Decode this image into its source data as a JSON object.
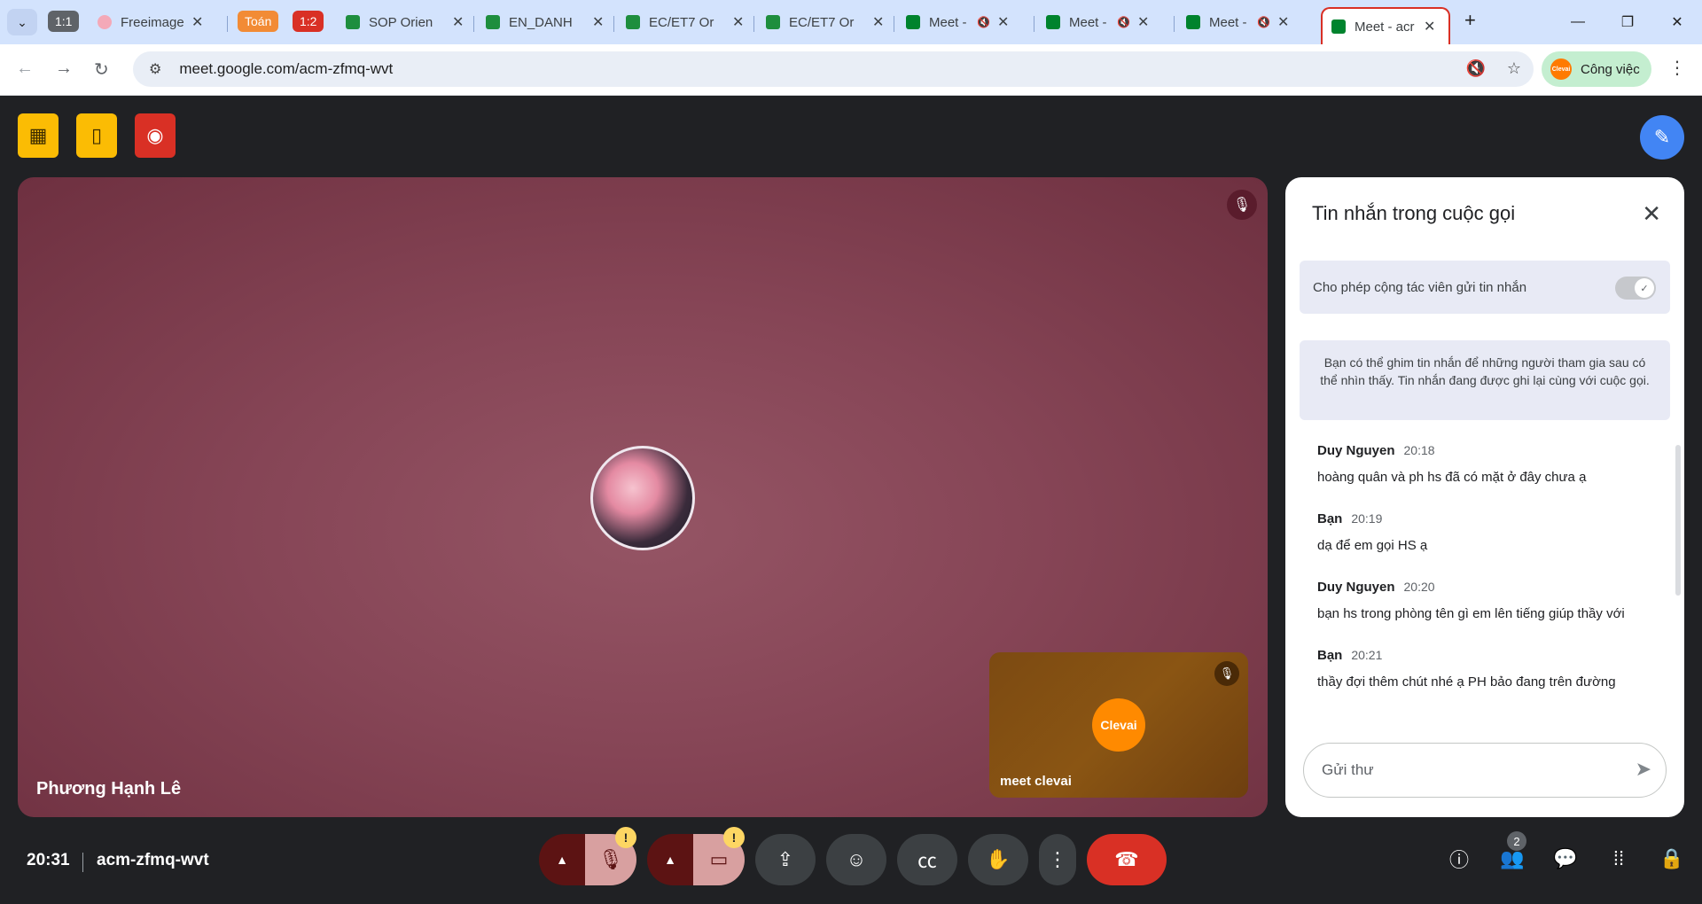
{
  "browser": {
    "tab_groups": [
      {
        "label": "1:1",
        "color": "#5f6368"
      },
      {
        "label": "Toán",
        "color": "#f28b35"
      },
      {
        "label": "1:2",
        "color": "#d93025"
      }
    ],
    "tabs": [
      {
        "title": "Freeimage",
        "favicon_color": "#f4a9b8"
      },
      {
        "title": "SOP Orien",
        "favicon_color": "#1e8e3e"
      },
      {
        "title": "EN_DANH",
        "favicon_color": "#1e8e3e"
      },
      {
        "title": "EC/ET7 Or",
        "favicon_color": "#1e8e3e"
      },
      {
        "title": "EC/ET7 Or",
        "favicon_color": "#1e8e3e"
      },
      {
        "title": "Meet -",
        "favicon_color": "#00832d"
      },
      {
        "title": "Meet -",
        "favicon_color": "#00832d"
      },
      {
        "title": "Meet -",
        "favicon_color": "#00832d"
      },
      {
        "title": "Meet - acr",
        "favicon_color": "#00832d"
      }
    ],
    "url": "meet.google.com/acm-zfmq-wvt",
    "profile_label": "Công việc",
    "profile_avatar_text": "Clevai"
  },
  "meet": {
    "main_participant": "Phương Hạnh Lê",
    "self_participant": "meet clevai",
    "self_avatar_text": "Clevai",
    "clock": "20:31",
    "meeting_code": "acm-zfmq-wvt",
    "participant_count": "2"
  },
  "chat": {
    "title": "Tin nhắn trong cuộc gọi",
    "permission_label": "Cho phép cộng tác viên gửi tin nhắn",
    "info_text": "Bạn có thể ghim tin nhắn để những người tham gia sau có thể nhìn thấy. Tin nhắn đang được ghi lại cùng với cuộc gọi.",
    "messages": [
      {
        "sender": "Duy Nguyen",
        "time": "20:18",
        "text": "hoàng quân và ph hs đã có mặt ở đây chưa ạ"
      },
      {
        "sender": "Bạn",
        "time": "20:19",
        "text": "dạ để em gọi HS ạ"
      },
      {
        "sender": "Duy Nguyen",
        "time": "20:20",
        "text": "bạn hs trong phòng tên gì em lên tiếng giúp thầy với"
      },
      {
        "sender": "Bạn",
        "time": "20:21",
        "text": "thầy đợi thêm chút nhé ạ PH bảo đang trên đường"
      }
    ],
    "input_placeholder": "Gửi thư"
  },
  "warning_glyph": "!"
}
